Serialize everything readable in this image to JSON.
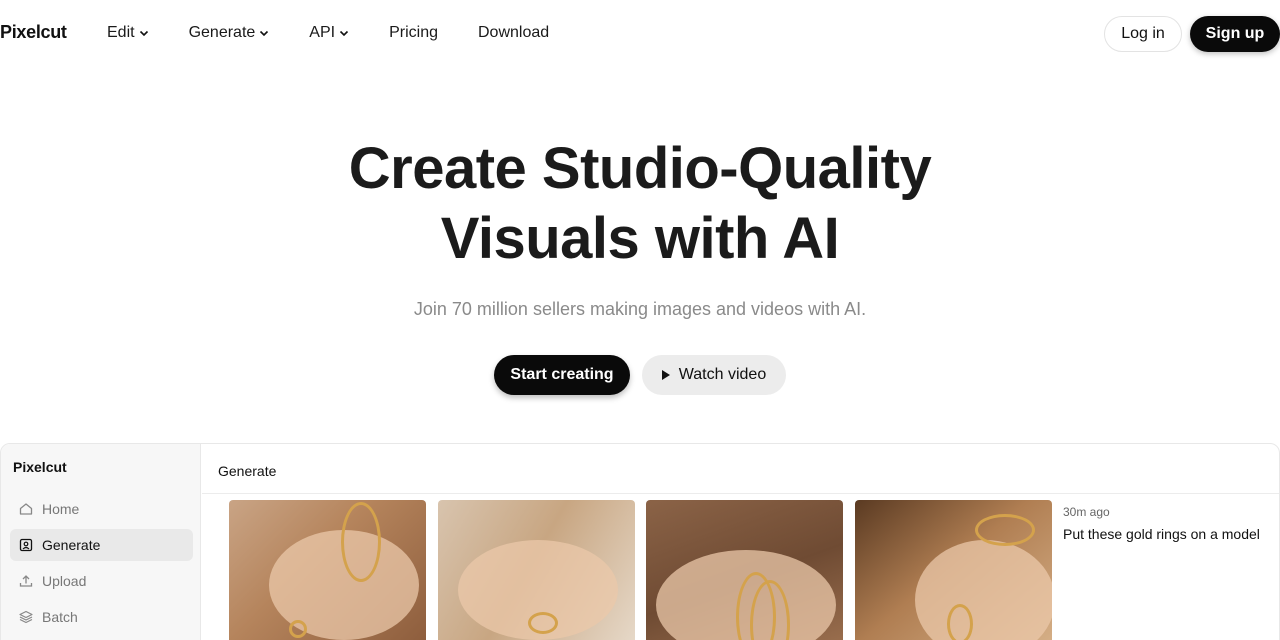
{
  "nav": {
    "logo": "Pixelcut",
    "links": [
      {
        "label": "Edit",
        "dropdown": true
      },
      {
        "label": "Generate",
        "dropdown": true
      },
      {
        "label": "API",
        "dropdown": true
      },
      {
        "label": "Pricing",
        "dropdown": false
      },
      {
        "label": "Download",
        "dropdown": false
      }
    ],
    "login": "Log in",
    "signup": "Sign up"
  },
  "hero": {
    "title_line1": "Create Studio-Quality",
    "title_line2": "Visuals with AI",
    "subtitle": "Join 70 million sellers making images and videos with AI.",
    "cta_primary": "Start creating",
    "cta_secondary": "Watch video"
  },
  "app_preview": {
    "sidebar": {
      "title": "Pixelcut",
      "items": [
        {
          "label": "Home",
          "icon": "home-icon",
          "active": false
        },
        {
          "label": "Generate",
          "icon": "generate-icon",
          "active": true
        },
        {
          "label": "Upload",
          "icon": "upload-icon",
          "active": false
        },
        {
          "label": "Batch",
          "icon": "layers-icon",
          "active": false
        }
      ]
    },
    "header": "Generate",
    "result": {
      "time": "30m ago",
      "prompt": "Put these gold rings on a model"
    }
  },
  "colors": {
    "primary_button": "#0a0a0a",
    "secondary_button": "#ececec",
    "subtitle_text": "#8a8a8a"
  }
}
